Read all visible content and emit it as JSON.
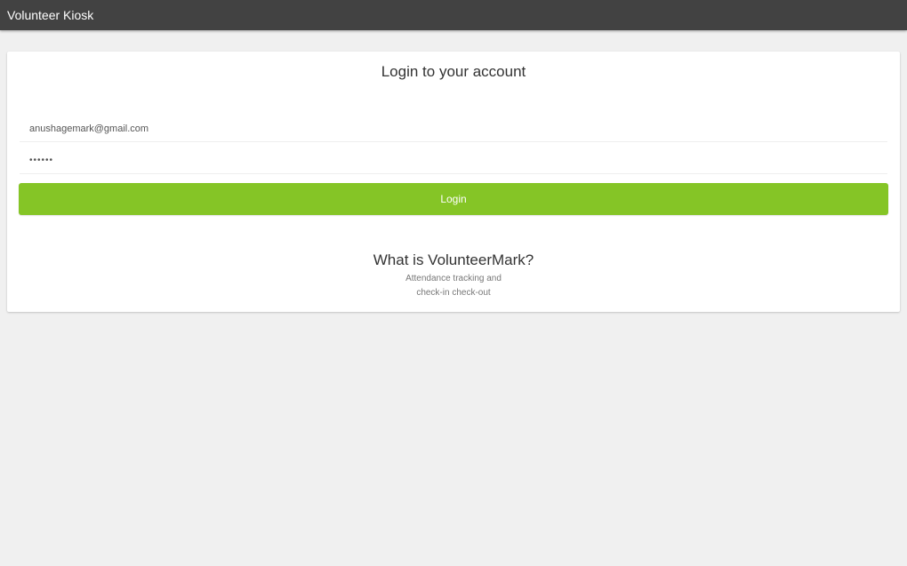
{
  "app_bar": {
    "title": "Volunteer Kiosk"
  },
  "login_form": {
    "title": "Login to your account",
    "email_value": "anushagemark@gmail.com",
    "password_value": "••••••",
    "login_button_label": "Login"
  },
  "about": {
    "title": "What is VolunteerMark?",
    "line_1": "Attendance tracking and",
    "line_2": "check-in   check-out"
  },
  "colors": {
    "app_bar": "#424242",
    "background": "#f0f0f0",
    "card": "#ffffff",
    "login_button": "#85c526"
  }
}
